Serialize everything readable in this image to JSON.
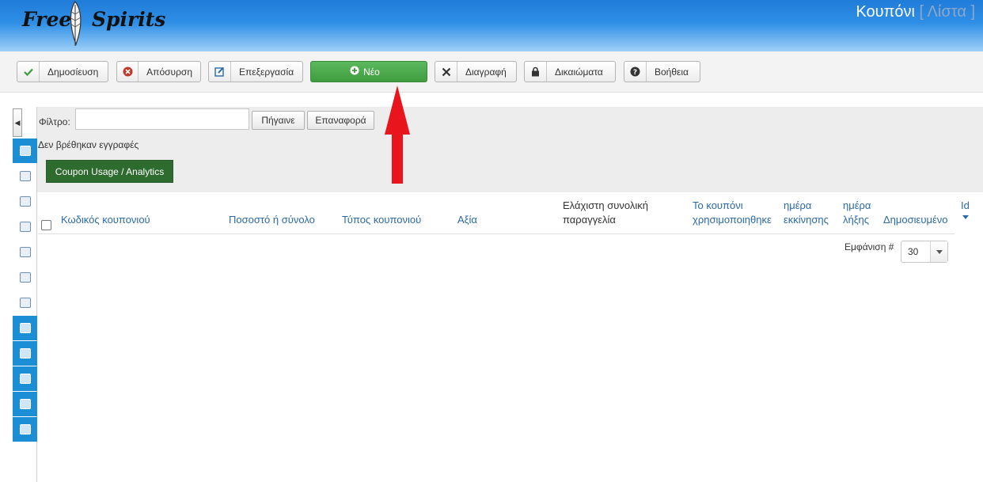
{
  "header": {
    "logo_word1": "Free",
    "logo_word2": "Spirits",
    "title": "Κουπόνι",
    "subtitle": "[ Λίστα ]",
    "colors": {
      "gradient_top": "#1f7cd9",
      "gradient_bottom": "#9fd0f7"
    }
  },
  "toolbar": {
    "buttons": [
      {
        "label": "Δημοσίευση",
        "icon": "check-icon"
      },
      {
        "label": "Απόσυρση",
        "icon": "unpublish-icon"
      },
      {
        "label": "Επεξεργασία",
        "icon": "edit-icon"
      },
      {
        "label": "Νέο",
        "icon": "plus-circle-icon",
        "color": "#4cae4c"
      },
      {
        "label": "Διαγραφή",
        "icon": "delete-icon"
      },
      {
        "label": "Δικαιώματα",
        "icon": "lock-icon"
      },
      {
        "label": "Βοήθεια",
        "icon": "help-icon"
      }
    ]
  },
  "sidebar": {
    "items": [
      {
        "icon": "coupons-icon",
        "active": true
      },
      {
        "icon": "folders-icon",
        "active": false
      },
      {
        "icon": "media-icon",
        "active": false
      },
      {
        "icon": "orders-icon",
        "active": false
      },
      {
        "icon": "reports-icon",
        "active": false
      },
      {
        "icon": "calendar-icon",
        "active": false
      },
      {
        "icon": "comments-icon",
        "active": false
      },
      {
        "icon": "pages-icon",
        "active": true
      },
      {
        "icon": "tools-icon",
        "active": true
      },
      {
        "icon": "install-icon",
        "active": true
      },
      {
        "icon": "settings-icon",
        "active": true
      },
      {
        "icon": "extensions-icon",
        "active": true
      }
    ]
  },
  "filter": {
    "label": "Φίλτρο:",
    "value": "",
    "go_label": "Πήγαινε",
    "reset_label": "Επαναφορά"
  },
  "no_records": "Δεν βρέθηκαν εγγραφές",
  "analytics_button": "Coupon Usage / Analytics",
  "table": {
    "columns": [
      {
        "lines": [
          "Κωδικός κουπονιού"
        ]
      },
      {
        "lines": [
          "Ποσοστό ή σύνολο"
        ]
      },
      {
        "lines": [
          "Τύπος κουπονιού"
        ]
      },
      {
        "lines": [
          "Αξία"
        ]
      },
      {
        "lines": [
          "Ελάχιστη συνολική",
          "παραγγελία"
        ]
      },
      {
        "lines": [
          "Το κουπόνι",
          "χρησιμοποιηθηκε"
        ]
      },
      {
        "lines": [
          "ημέρα",
          "εκκίνησης"
        ]
      },
      {
        "lines": [
          "ημέρα",
          "λήξης"
        ]
      },
      {
        "lines": [
          "Δημοσιευμένο"
        ]
      },
      {
        "lines": [
          "Id"
        ]
      }
    ]
  },
  "pagination": {
    "display_label": "Εμφάνιση #",
    "limit": "30"
  }
}
